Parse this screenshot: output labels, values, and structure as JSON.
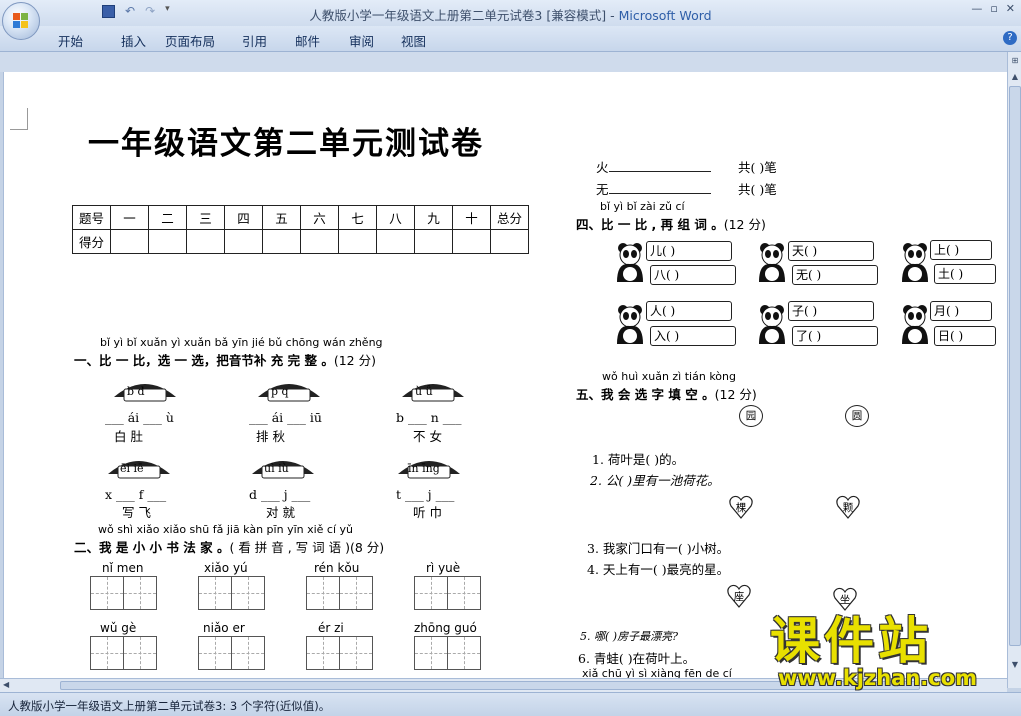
{
  "window": {
    "title": "人教版小学一年级语文上册第二单元试卷3 [兼容模式]",
    "app_name": "Microsoft Word",
    "separator": " - "
  },
  "ribbon": {
    "tabs": [
      "开始",
      "插入",
      "页面布局",
      "引用",
      "邮件",
      "审阅",
      "视图"
    ]
  },
  "status": {
    "text": "人教版小学一年级语文上册第二单元试卷3: 3 个字符(近似值)。"
  },
  "doc": {
    "title": "一年级语文第二单元测试卷",
    "table": {
      "row1": [
        "题号",
        "一",
        "二",
        "三",
        "四",
        "五",
        "六",
        "七",
        "八",
        "九",
        "十",
        "总分"
      ],
      "row2_label": "得分"
    },
    "s1": {
      "pinyin": "bǐ yì bǐ   xuǎn yì xuǎn   bǎ yīn jié bǔ chōng wán zhěng",
      "heading": "一、比 一 比，选 一 选，把音节补 充 完 整 。",
      "points": "(12 分)",
      "mushrooms": [
        {
          "label": "b   d",
          "blanks": "___ ái  ___ ù",
          "chars": "白    肚"
        },
        {
          "label": "p   q",
          "blanks": "___ ái  ___ iū",
          "chars": "排    秋"
        },
        {
          "label": "ù   ǚ",
          "blanks": "b ___   n ___",
          "chars": "不    女"
        },
        {
          "label": "ēi  iē",
          "blanks": "x ___   f ___",
          "chars": "写    飞"
        },
        {
          "label": "uì  iù",
          "blanks": "d ___   j ___",
          "chars": "对    就"
        },
        {
          "label": "īn  īng",
          "blanks": "t ___   j ___",
          "chars": "听    巾"
        }
      ]
    },
    "s2": {
      "pinyin": "wǒ shì xiǎo xiǎo shū fǎ jiā      kàn pīn yīn   xiě cí yǔ",
      "heading": "二、我 是 小 小 书 法 家 。",
      "sub": "( 看 拼 音 , 写 词 语 )",
      "points": "(8 分)",
      "words": [
        {
          "py": "nǐ   men"
        },
        {
          "py": "xiǎo   yú"
        },
        {
          "py": "rén   kǒu"
        },
        {
          "py": "rì   yuè"
        },
        {
          "py": "wǔ   gè"
        },
        {
          "py": "niǎo   er"
        },
        {
          "py": "ér   zi"
        },
        {
          "py": "zhōng  guó"
        }
      ]
    },
    "top_right": {
      "line1_char": "火",
      "line1_tail": "共(     )笔",
      "line2_char": "无",
      "line2_tail": "共(     )笔"
    },
    "s4": {
      "pinyin": "bǐ  yì  bǐ   zài zǔ  cí",
      "heading": "四、比 一 比 , 再 组 词 。",
      "points": "(12 分)",
      "pairs": [
        [
          "儿(      )",
          "八(      )"
        ],
        [
          "天(      )",
          "无(      )"
        ],
        [
          "上(      )",
          "土(      )"
        ],
        [
          "人(      )",
          "入(      )"
        ],
        [
          "子(      )",
          "了(      )"
        ],
        [
          "月(      )",
          "日(      )"
        ]
      ]
    },
    "s5": {
      "pinyin": "wǒ huì xuǎn zì tián kòng",
      "heading": "五、我 会 选 字 填 空 。",
      "points": "(12 分)",
      "ovals": [
        "园",
        "圆"
      ],
      "hearts1": [
        "棵",
        "颗"
      ],
      "hearts2": [
        "座",
        "坐"
      ],
      "q1": "1. 荷叶是(      )的。",
      "q2": "2. 公(      )里有一池荷花。",
      "q3": "3. 我家门口有一(      )小树。",
      "q4": "4. 天上有一(      )最亮的星。",
      "q5": "5. 哪(      )房子最漂亮?",
      "q6": "6. 青蛙(      )在荷叶上。",
      "bottom_py": "xiǎ chū  yì  sì  xiàng fēn de cí"
    }
  },
  "watermark": {
    "title": "课件站",
    "url": "www.kjzhan.com"
  }
}
